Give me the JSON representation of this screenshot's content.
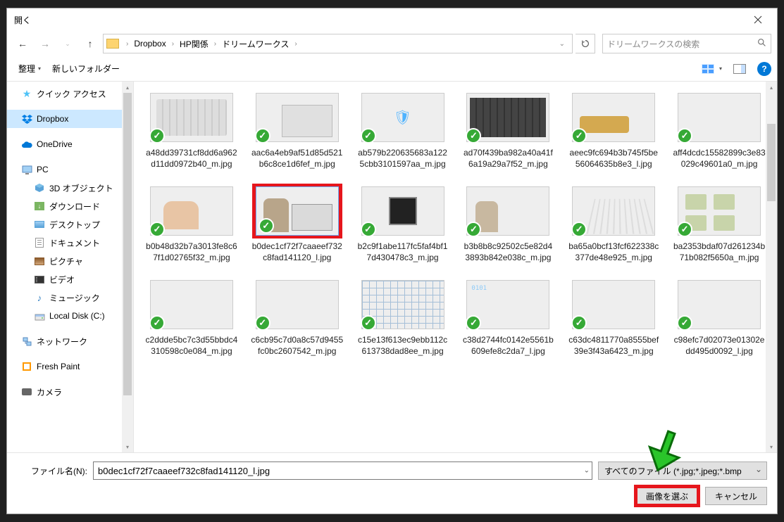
{
  "title": "開く",
  "breadcrumb": [
    "Dropbox",
    "HP関係",
    "ドリームワークス"
  ],
  "search_placeholder": "ドリームワークスの検索",
  "toolbar": {
    "organize": "整理",
    "newfolder": "新しいフォルダー"
  },
  "sidebar": {
    "quick": "クイック アクセス",
    "dropbox": "Dropbox",
    "onedrive": "OneDrive",
    "pc": "PC",
    "objects3d": "3D オブジェクト",
    "downloads": "ダウンロード",
    "desktop": "デスクトップ",
    "documents": "ドキュメント",
    "pictures": "ピクチャ",
    "videos": "ビデオ",
    "music": "ミュージック",
    "localdisk": "Local Disk (C:)",
    "network": "ネットワーク",
    "freshpaint": "Fresh Paint",
    "camera": "カメラ"
  },
  "files": [
    {
      "name": "a48dd39731cf8dd6a962d11dd0972b40_m.jpg",
      "cls": "th-kb"
    },
    {
      "name": "aac6a4eb9af51d85d521b6c8ce1d6fef_m.jpg",
      "cls": "th-hand"
    },
    {
      "name": "ab579b220635683a1225cbb3101597aa_m.jpg",
      "cls": "th-shield"
    },
    {
      "name": "ad70f439ba982a40a41f6a19a29a7f52_m.jpg",
      "cls": "th-dkb"
    },
    {
      "name": "aeec9fc694b3b745f5be56064635b8e3_l.jpg",
      "cls": "th-usb"
    },
    {
      "name": "aff4dcdc15582899c3e83029c49601a0_m.jpg",
      "cls": "th-pc"
    },
    {
      "name": "b0b48d32b7a3013fe8c67f1d02765f32_m.jpg",
      "cls": "th-woman"
    },
    {
      "name": "b0dec1cf72f7caaeef732c8fad141120_l.jpg",
      "cls": "th-dog",
      "selected": true
    },
    {
      "name": "b2c9f1abe117fc5faf4bf17d430478c3_m.jpg",
      "cls": "th-board"
    },
    {
      "name": "b3b8b8c92502c5e82d43893b842e038c_m.jpg",
      "cls": "th-dog2"
    },
    {
      "name": "ba65a0bcf13fcf622338c377de48e925_m.jpg",
      "cls": "th-type"
    },
    {
      "name": "ba2353bdaf07d261234b71b082f5650a_m.jpg",
      "cls": "th-drives"
    },
    {
      "name": "c2ddde5bc7c3d55bbdc4310598c0e084_m.jpg",
      "cls": "th-steth"
    },
    {
      "name": "c6cb95c7d0a8c57d9455fc0bc2607542_m.jpg",
      "cls": "th-pen"
    },
    {
      "name": "c15e13f613ec9ebb112c613738dad8ee_m.jpg",
      "cls": "th-net"
    },
    {
      "name": "c38d2744fc0142e5561b609efe8c2da7_l.jpg",
      "cls": "th-bin"
    },
    {
      "name": "c63dc4811770a8555bef39e3f43a6423_m.jpg",
      "cls": "th-ppl"
    },
    {
      "name": "c98efc7d02073e01302edd495d0092_l.jpg",
      "cls": "th-mb"
    }
  ],
  "footer": {
    "fname_label": "ファイル名(N):",
    "fname_value": "b0dec1cf72f7caaeef732c8fad141120_l.jpg",
    "ftype": "すべてのファイル (*.jpg;*.jpeg;*.bmp",
    "open": "画像を選ぶ",
    "cancel": "キャンセル"
  }
}
